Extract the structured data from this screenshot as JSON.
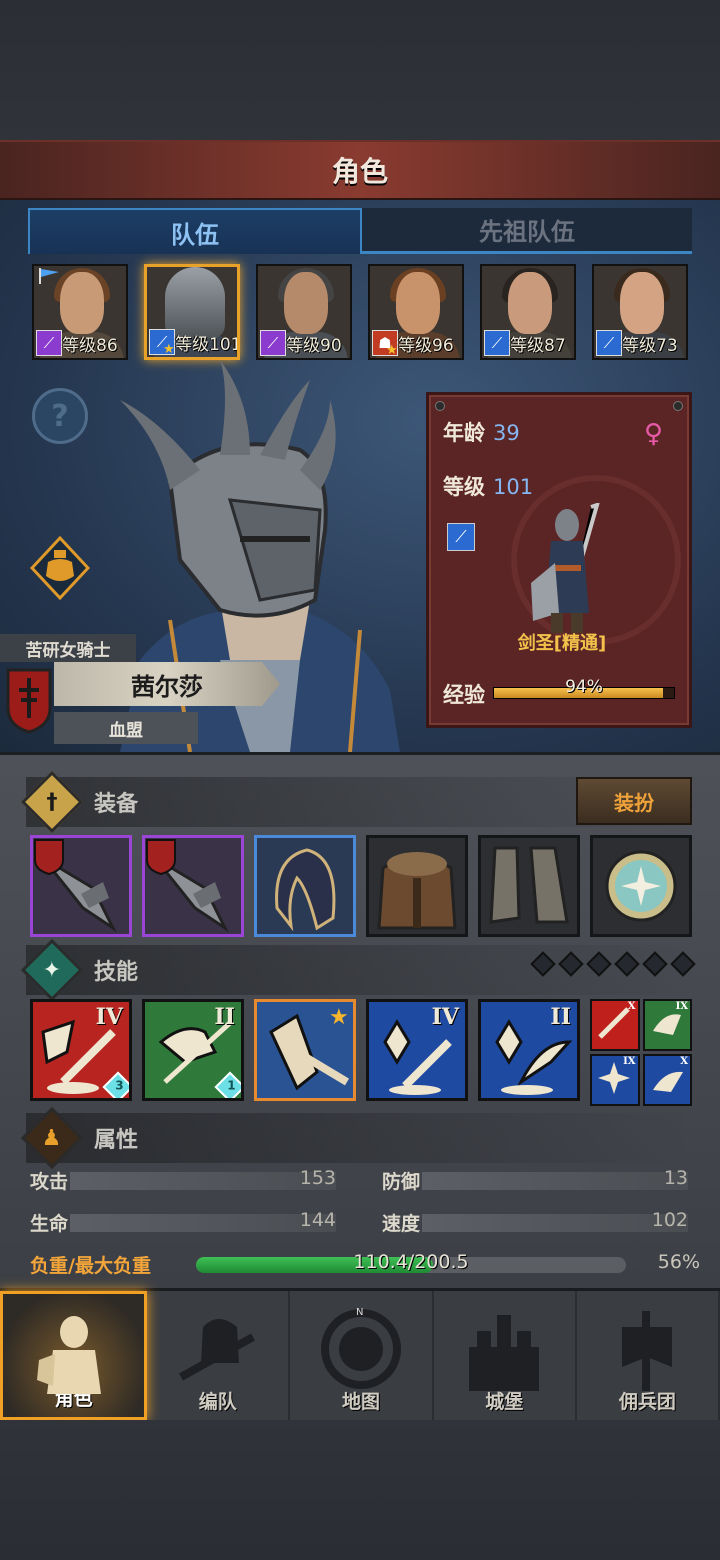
{
  "header": {
    "title": "角色"
  },
  "tabs": [
    {
      "label": "队伍",
      "active": true
    },
    {
      "label": "先祖队伍",
      "active": false
    }
  ],
  "party": [
    {
      "level": "等级86",
      "class": "purple-staff",
      "selected": false,
      "leader": true
    },
    {
      "level": "等级101",
      "class": "blue-sword-star",
      "selected": true,
      "leader": false
    },
    {
      "level": "等级90",
      "class": "purple-staff",
      "selected": false,
      "leader": false
    },
    {
      "level": "等级96",
      "class": "red-beast-star",
      "selected": false,
      "leader": false
    },
    {
      "level": "等级87",
      "class": "blue-sword",
      "selected": false,
      "leader": false
    },
    {
      "level": "等级73",
      "class": "blue-sword",
      "selected": false,
      "leader": false
    }
  ],
  "character": {
    "title": "苦研女骑士",
    "name": "茜尔莎",
    "faction": "血盟",
    "age_label": "年龄",
    "age": "39",
    "level_label": "等级",
    "level": "101",
    "class_name": "剑圣[精通]",
    "exp_label": "经验",
    "exp_percent": "94%",
    "exp_fraction": 0.94
  },
  "equipment": {
    "title": "装备",
    "dress_button": "装扮",
    "slots": [
      "greatsword",
      "greatsword",
      "hood",
      "fur-coat",
      "boots",
      "amulet"
    ]
  },
  "skills": {
    "title": "技能",
    "items": [
      {
        "rank": "IV",
        "color": "red",
        "gem": "3"
      },
      {
        "rank": "II",
        "color": "green",
        "gem": "1"
      },
      {
        "rank": "",
        "color": "blue",
        "gem": ""
      },
      {
        "rank": "IV",
        "color": "blue",
        "gem": ""
      },
      {
        "rank": "II",
        "color": "blue",
        "gem": ""
      }
    ],
    "mini": [
      "X",
      "IX",
      "IX",
      "X"
    ]
  },
  "attributes": {
    "title": "属性",
    "attack_label": "攻击",
    "attack": "153",
    "defense_label": "防御",
    "defense": "13",
    "hp_label": "生命",
    "hp": "144",
    "speed_label": "速度",
    "speed": "102",
    "load_label": "负重/最大负重",
    "load": "110.4/200.5",
    "load_pct": "56%",
    "load_fraction": 0.55
  },
  "nav": [
    {
      "label": "角色",
      "active": true
    },
    {
      "label": "编队",
      "active": false
    },
    {
      "label": "地图",
      "active": false
    },
    {
      "label": "城堡",
      "active": false
    },
    {
      "label": "佣兵团",
      "active": false
    }
  ],
  "colors": {
    "accent": "#f0a024",
    "tab_blue": "#3d86c6",
    "load_green": "#3fc056",
    "card_red": "#5b2525"
  }
}
